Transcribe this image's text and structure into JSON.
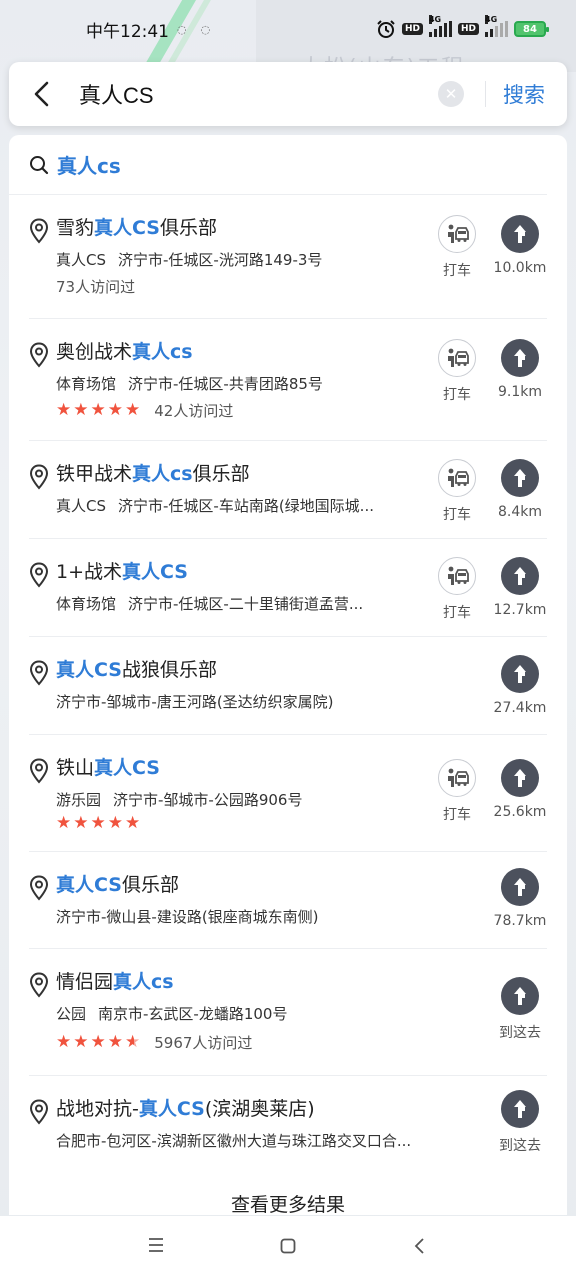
{
  "status": {
    "time": "中午12:41",
    "network1": "4G",
    "network2": "4G",
    "hd": "HD",
    "battery": "84"
  },
  "map": {
    "label": "大松(山东)工程"
  },
  "search": {
    "query": "真人CS",
    "button_label": "搜索"
  },
  "suggestion": {
    "text": "真人cs"
  },
  "results": [
    {
      "title_pre": "雪豹",
      "title_hl": "真人CS",
      "title_post": "俱乐部",
      "category": "真人CS",
      "address": "济宁市-任城区-洸河路149-3号",
      "stars": 0,
      "visits": "73人访问过",
      "taxi": true,
      "taxi_label": "打车",
      "distance": "10.0km"
    },
    {
      "title_pre": "奥创战术",
      "title_hl": "真人cs",
      "title_post": "",
      "category": "体育场馆",
      "address": "济宁市-任城区-共青团路85号",
      "stars": 5,
      "visits": "42人访问过",
      "taxi": true,
      "taxi_label": "打车",
      "distance": "9.1km"
    },
    {
      "title_pre": "铁甲战术",
      "title_hl": "真人cs",
      "title_post": "俱乐部",
      "category": "真人CS",
      "address": "济宁市-任城区-车站南路(绿地国际城...",
      "stars": 0,
      "visits": "",
      "taxi": true,
      "taxi_label": "打车",
      "distance": "8.4km"
    },
    {
      "title_pre": "1+战术",
      "title_hl": "真人CS",
      "title_post": "",
      "category": "体育场馆",
      "address": "济宁市-任城区-二十里铺街道孟营...",
      "stars": 0,
      "visits": "",
      "taxi": true,
      "taxi_label": "打车",
      "distance": "12.7km"
    },
    {
      "title_pre": "",
      "title_hl": "真人CS",
      "title_post": "战狼俱乐部",
      "category": "",
      "address": "济宁市-邹城市-唐王河路(圣达纺织家属院)",
      "stars": 0,
      "visits": "",
      "taxi": false,
      "taxi_label": "",
      "distance": "27.4km"
    },
    {
      "title_pre": "铁山",
      "title_hl": "真人CS",
      "title_post": "",
      "category": "游乐园",
      "address": "济宁市-邹城市-公园路906号",
      "stars": 5,
      "visits": "",
      "taxi": true,
      "taxi_label": "打车",
      "distance": "25.6km"
    },
    {
      "title_pre": "",
      "title_hl": "真人CS",
      "title_post": "俱乐部",
      "category": "",
      "address": "济宁市-微山县-建设路(银座商城东南侧)",
      "stars": 0,
      "visits": "",
      "taxi": false,
      "taxi_label": "",
      "distance": "78.7km"
    },
    {
      "title_pre": "情侣园",
      "title_hl": "真人cs",
      "title_post": "",
      "category": "公园",
      "address": "南京市-玄武区-龙蟠路100号",
      "stars": 4.5,
      "visits": "5967人访问过",
      "taxi": false,
      "taxi_label": "",
      "distance": "到这去"
    },
    {
      "title_pre": "战地对抗-",
      "title_hl": "真人CS",
      "title_post": "(滨湖奥莱店)",
      "category": "",
      "address": "合肥市-包河区-滨湖新区徽州大道与珠江路交叉口合...",
      "stars": 0,
      "visits": "",
      "taxi": false,
      "taxi_label": "",
      "distance": "到这去"
    }
  ],
  "more_results": "查看更多结果",
  "colors": {
    "accent": "#2f7cd6",
    "star": "#f0533e",
    "nav_button": "#4c515d"
  }
}
